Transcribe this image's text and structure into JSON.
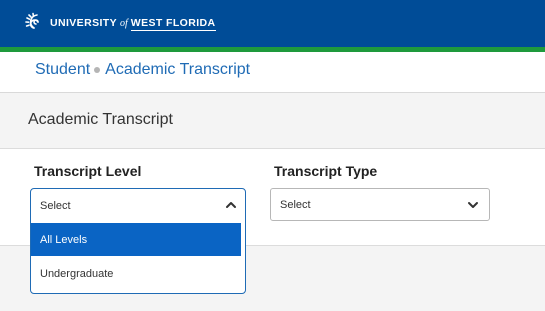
{
  "header": {
    "logo_part1": "UNIVERSITY",
    "logo_of": "of",
    "logo_part2": "WEST FLORIDA",
    "accent": "#004c97",
    "stripe": "#1e9a3c"
  },
  "breadcrumb": {
    "items": [
      "Student",
      "Academic Transcript"
    ]
  },
  "page": {
    "title": "Academic Transcript"
  },
  "form": {
    "level": {
      "label": "Transcript Level",
      "value": "Select",
      "open": true,
      "options": [
        "All Levels",
        "Undergraduate"
      ],
      "highlighted": "All Levels"
    },
    "type": {
      "label": "Transcript Type",
      "value": "Select"
    }
  },
  "icons": {
    "logo": "nautilus-shell-icon",
    "level_chevron": "chevron-up-icon",
    "type_chevron": "chevron-down-icon"
  }
}
